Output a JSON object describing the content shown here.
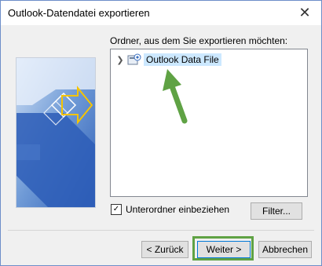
{
  "window": {
    "title": "Outlook-Datendatei exportieren",
    "close_glyph": "✕"
  },
  "main": {
    "prompt": "Ordner, aus dem Sie exportieren möchten:",
    "tree": [
      {
        "label": "Outlook Data File",
        "expanded": false,
        "selected": true
      }
    ],
    "include_subfolders": {
      "label": "Unterordner einbeziehen",
      "checked": true,
      "check_glyph": "✓"
    },
    "filter_label": "Filter...",
    "expander_glyph": "❯"
  },
  "footer": {
    "back_label": "< Zurück",
    "next_label": "Weiter >",
    "cancel_label": "Abbrechen"
  },
  "colors": {
    "annotation_green": "#5fa244",
    "selection": "#cce8ff"
  }
}
